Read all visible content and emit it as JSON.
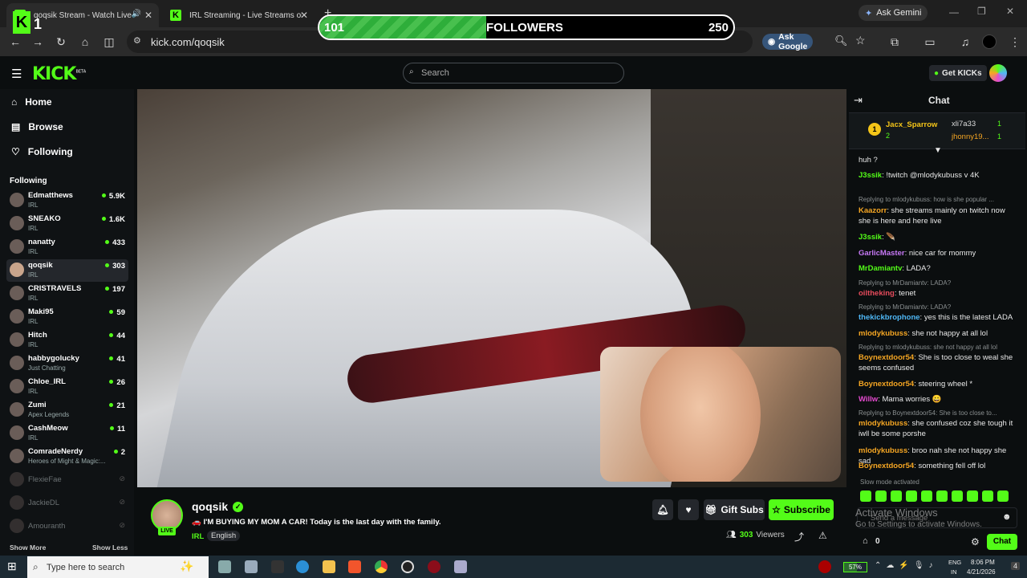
{
  "browser": {
    "tabs": [
      {
        "label": "qoqsik Stream - Watch Live on Ki"
      },
      {
        "label": "IRL Streaming - Live Streams on Kick"
      }
    ],
    "new_tab": "+",
    "ask_gemini": "Ask Gemini",
    "url": "kick.com/qoqsik",
    "ask_google": "Ask Google"
  },
  "overlay": {
    "count_left": "101",
    "label": "FOLLOWERS",
    "count_right": "250",
    "progress": 0.404,
    "corner_number": "1"
  },
  "kick": {
    "logo": "KICK",
    "logo_sup": "BETA",
    "search_placeholder": "Search",
    "get_kicks": "Get KICKs",
    "nav": [
      {
        "label": "Home",
        "icon": "home-icon"
      },
      {
        "label": "Browse",
        "icon": "browse-icon"
      },
      {
        "label": "Following",
        "icon": "heart-icon"
      }
    ],
    "following_header": "Following",
    "following": [
      {
        "name": "Edmatthews",
        "cat": "IRL",
        "viewers": "5.9K"
      },
      {
        "name": "SNEAKO",
        "cat": "IRL",
        "viewers": "1.6K"
      },
      {
        "name": "nanatty",
        "cat": "IRL",
        "viewers": "433"
      },
      {
        "name": "qoqsik",
        "cat": "IRL",
        "viewers": "303"
      },
      {
        "name": "CRISTRAVELS",
        "cat": "IRL",
        "viewers": "197"
      },
      {
        "name": "Maki95",
        "cat": "IRL",
        "viewers": "59"
      },
      {
        "name": "Hitch",
        "cat": "IRL",
        "viewers": "44"
      },
      {
        "name": "habbygolucky",
        "cat": "Just Chatting",
        "viewers": "41"
      },
      {
        "name": "Chloe_IRL",
        "cat": "IRL",
        "viewers": "26"
      },
      {
        "name": "Zumi",
        "cat": "Apex Legends",
        "viewers": "21"
      },
      {
        "name": "CashMeow",
        "cat": "IRL",
        "viewers": "11"
      },
      {
        "name": "ComradeNerdy",
        "cat": "Heroes of Might & Magic:...",
        "viewers": "2"
      }
    ],
    "offline": [
      "FlexieFae",
      "JackieDL",
      "Amouranth"
    ],
    "show_more": "Show More",
    "show_less": "Show Less"
  },
  "stream": {
    "channel": "qoqsik",
    "live": "LIVE",
    "title": "🚗 I'M BUYING MY MOM A CAR! Today is the last day with the family.",
    "category": "IRL",
    "language": "English",
    "gift_subs": "Gift Subs",
    "subscribe": "Subscribe",
    "viewers_count": "303",
    "viewers_label": "Viewers"
  },
  "chat": {
    "title": "Chat",
    "leaderboard": {
      "first": "Jacx_Sparrow",
      "first_count": "2",
      "second": "xli7a33",
      "second_count": "1",
      "third": "jhonny19...",
      "third_count": "1",
      "rank": "1"
    },
    "messages": [
      {
        "type": "msg",
        "user": "",
        "text": "huh ?",
        "color": "#e8e8e8"
      },
      {
        "type": "msg",
        "user": "J3ssik",
        "text": "!twitch @mlodykubuss v 4K",
        "color": "#53fc18"
      },
      {
        "type": "reply",
        "text": "Replying to mlodykubuss: how is she popular ..."
      },
      {
        "type": "msg",
        "user": "Kaazorr",
        "text": "she streams mainly on twitch now she is here and here live",
        "color": "#f5a623"
      },
      {
        "type": "msg",
        "user": "J3ssik",
        "text": "🪶",
        "color": "#53fc18"
      },
      {
        "type": "msg",
        "user": "GarlicMaster",
        "text": "nice car for mommy",
        "color": "#c678f5"
      },
      {
        "type": "msg",
        "user": "MrDamiantv",
        "text": "LADA?",
        "color": "#53fc18"
      },
      {
        "type": "reply",
        "text": "Replying to MrDamiantv: LADA?"
      },
      {
        "type": "msg",
        "user": "oiltheking",
        "text": "tenet",
        "color": "#e64b5c"
      },
      {
        "type": "reply",
        "text": "Replying to MrDamiantv: LADA?"
      },
      {
        "type": "msg",
        "user": "thekickbrophone",
        "text": "yes this is the latest LADA",
        "color": "#4fb7f5"
      },
      {
        "type": "msg",
        "user": "mlodykubuss",
        "text": "she not happy at all lol",
        "color": "#f5a623"
      },
      {
        "type": "reply",
        "text": "Replying to mlodykubuss: she not happy at all lol"
      },
      {
        "type": "msg",
        "user": "Boynextdoor54",
        "text": "She is too close to weal she seems confused",
        "color": "#f5a623"
      },
      {
        "type": "msg",
        "user": "Boynextdoor54",
        "text": "steering wheel *",
        "color": "#f5a623"
      },
      {
        "type": "msg",
        "user": "Willw",
        "text": "Mama worries 😀",
        "color": "#e64bd0"
      },
      {
        "type": "reply",
        "text": "Replying to Boynextdoor54: She is too close to..."
      },
      {
        "type": "msg",
        "user": "mlodykubuss",
        "text": "she confused coz she tough it iwll be some porshe",
        "color": "#f5a623"
      },
      {
        "type": "msg",
        "user": "mlodykubuss",
        "text": "broo nah she not happy she sad",
        "color": "#f5a623"
      },
      {
        "type": "msg",
        "user": "Boynextdoor54",
        "text": "something fell off lol",
        "color": "#f5a623"
      }
    ],
    "slow_mode": "Slow mode activated",
    "send_placeholder": "Send a message",
    "activate_title": "Activate Windows",
    "activate_sub": "Go to Settings to activate Windows.",
    "kicks_count": "0",
    "chat_button": "Chat"
  },
  "taskbar": {
    "search": "Type here to search",
    "battery": "57%",
    "lang1": "ENG",
    "lang2": "IN",
    "time": "8:06 PM",
    "date": "4/21/2026",
    "notif": "4"
  }
}
